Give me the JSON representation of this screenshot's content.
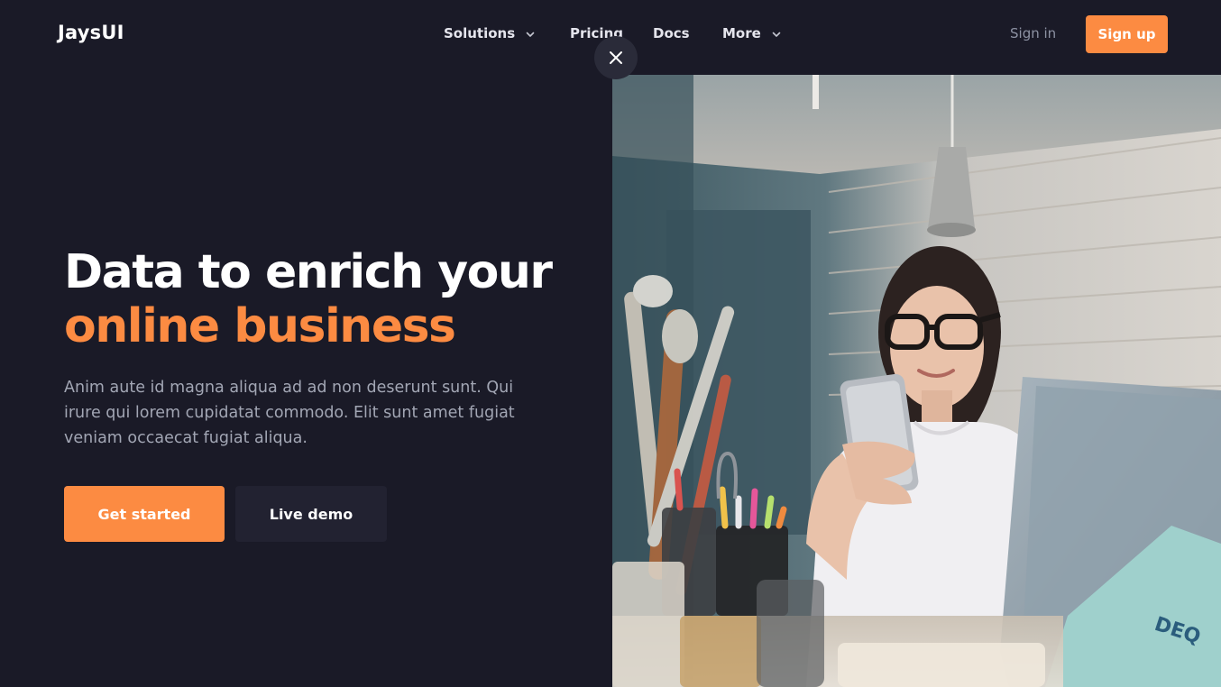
{
  "header": {
    "logo": "JaysUI",
    "nav": [
      {
        "label": "Solutions",
        "has_dropdown": true
      },
      {
        "label": "Pricing",
        "has_dropdown": false
      },
      {
        "label": "Docs",
        "has_dropdown": false
      },
      {
        "label": "More",
        "has_dropdown": true
      }
    ],
    "sign_in": "Sign in",
    "sign_up": "Sign up"
  },
  "hero": {
    "title_line1": "Data to enrich your",
    "title_line2": "online business",
    "description": "Anim aute id magna aliqua ad ad non deserunt sunt. Qui irure qui lorem cupidatat commodo. Elit sunt amet fugiat veniam occaecat fugiat aliqua.",
    "primary_cta": "Get started",
    "secondary_cta": "Live demo"
  },
  "icons": {
    "close": "close-icon",
    "dropdown": "chevron-down-icon"
  },
  "colors": {
    "background": "#1a1a27",
    "accent": "#fc8b42",
    "secondary_button": "#222231",
    "muted_text": "#a2a6b4"
  }
}
